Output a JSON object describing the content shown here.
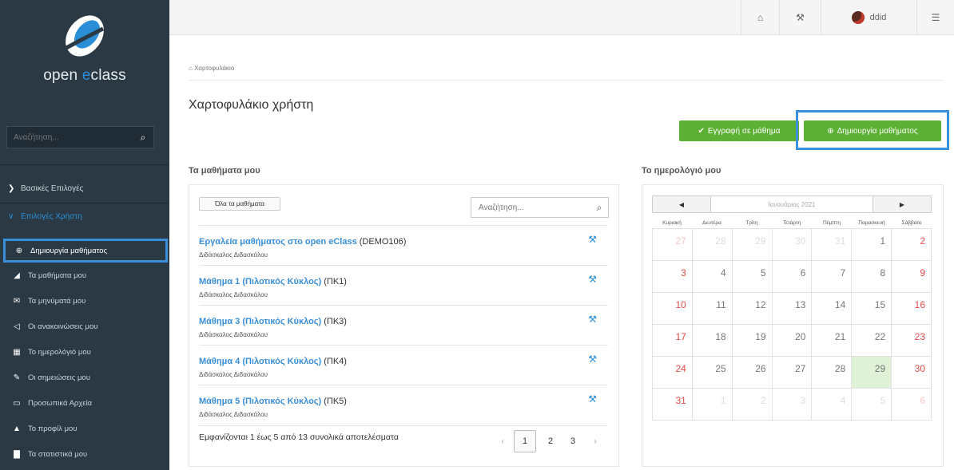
{
  "sidebar": {
    "logo_prefix": "open ",
    "logo_e": "e",
    "logo_suffix": "class",
    "search_placeholder": "Αναζήτηση...",
    "groups": [
      {
        "label": "Βασικές Επιλογές"
      },
      {
        "label": "Επιλογές Χρήστη"
      }
    ],
    "items": [
      {
        "label": "Δημιουργία μαθήματος",
        "icon": "plus-circle-icon"
      },
      {
        "label": "Τα μαθήματα μου",
        "icon": "graduation-cap-icon"
      },
      {
        "label": "Τα μηνύματά μου",
        "icon": "envelope-icon"
      },
      {
        "label": "Οι ανακοινώσεις μου",
        "icon": "bullhorn-icon"
      },
      {
        "label": "Το ημερολόγιό μου",
        "icon": "calendar-icon"
      },
      {
        "label": "Οι σημειώσεις μου",
        "icon": "edit-icon"
      },
      {
        "label": "Προσωπικά Αρχεία",
        "icon": "folder-icon"
      },
      {
        "label": "Το προφίλ μου",
        "icon": "user-icon"
      },
      {
        "label": "Τα στατιστικά μου",
        "icon": "bar-chart-icon"
      }
    ]
  },
  "topbar": {
    "username": "ddid"
  },
  "breadcrumb": "Χαρτοφυλάκιο",
  "page_title": "Χαρτοφυλάκιο χρήστη",
  "buttons": {
    "register": "Εγγραφή σε μάθημα",
    "create": "Δημιουργία μαθήματος"
  },
  "courses": {
    "section_title": "Τα μαθήματα μου",
    "filter_label": "Όλα τα μαθήματα",
    "search_placeholder": "Αναζήτηση...",
    "rows": [
      {
        "title": "Εργαλεία μαθήματος στο open eClass",
        "code": " (DEMO106)",
        "teacher": "Διδάσκαλος Διδασκάλου"
      },
      {
        "title": "Μάθημα 1 (Πιλοτικός Κύκλος)",
        "code": " (ΠΚ1)",
        "teacher": "Διδάσκαλος Διδασκάλου"
      },
      {
        "title": "Μάθημα 3 (Πιλοτικός Κύκλος)",
        "code": " (ΠΚ3)",
        "teacher": "Διδάσκαλος Διδασκάλου"
      },
      {
        "title": "Μάθημα 4 (Πιλοτικός Κύκλος)",
        "code": " (ΠΚ4)",
        "teacher": "Διδάσκαλος Διδασκάλου"
      },
      {
        "title": "Μάθημα 5 (Πιλοτικός Κύκλος)",
        "code": " (ΠΚ5)",
        "teacher": "Διδάσκαλος Διδασκάλου"
      }
    ],
    "results_text": "Εμφανίζονται 1 έως 5 από 13 συνολικά αποτελέσματα",
    "pager": {
      "prev": "‹",
      "pages": [
        "1",
        "2",
        "3"
      ],
      "next": "›",
      "current": "1"
    }
  },
  "calendar": {
    "section_title": "Το ημερολόγιό μου",
    "prev": "◀",
    "next": "▶",
    "month": "Ιανουάριος 2021",
    "weekdays": [
      "Κυριακή",
      "Δευτέρα",
      "Τρίτη",
      "Τετάρτη",
      "Πέμπτη",
      "Παρασκευή",
      "Σάββατο"
    ],
    "weeks": [
      [
        "27",
        "28",
        "29",
        "30",
        "31",
        "1",
        "2"
      ],
      [
        "3",
        "4",
        "5",
        "6",
        "7",
        "8",
        "9"
      ],
      [
        "10",
        "11",
        "12",
        "13",
        "14",
        "15",
        "16"
      ],
      [
        "17",
        "18",
        "19",
        "20",
        "21",
        "22",
        "23"
      ],
      [
        "24",
        "25",
        "26",
        "27",
        "28",
        "29",
        "30"
      ],
      [
        "31",
        "1",
        "2",
        "3",
        "4",
        "5",
        "6"
      ]
    ],
    "today": "29"
  },
  "colors": {
    "sidebar_bg": "#2b3944",
    "accent_blue": "#2a8fd7",
    "button_green": "#5cb034",
    "highlight_outline": "#3a8fd8",
    "weekend_red": "#e34a4a",
    "today_bg": "#dff2d8"
  }
}
